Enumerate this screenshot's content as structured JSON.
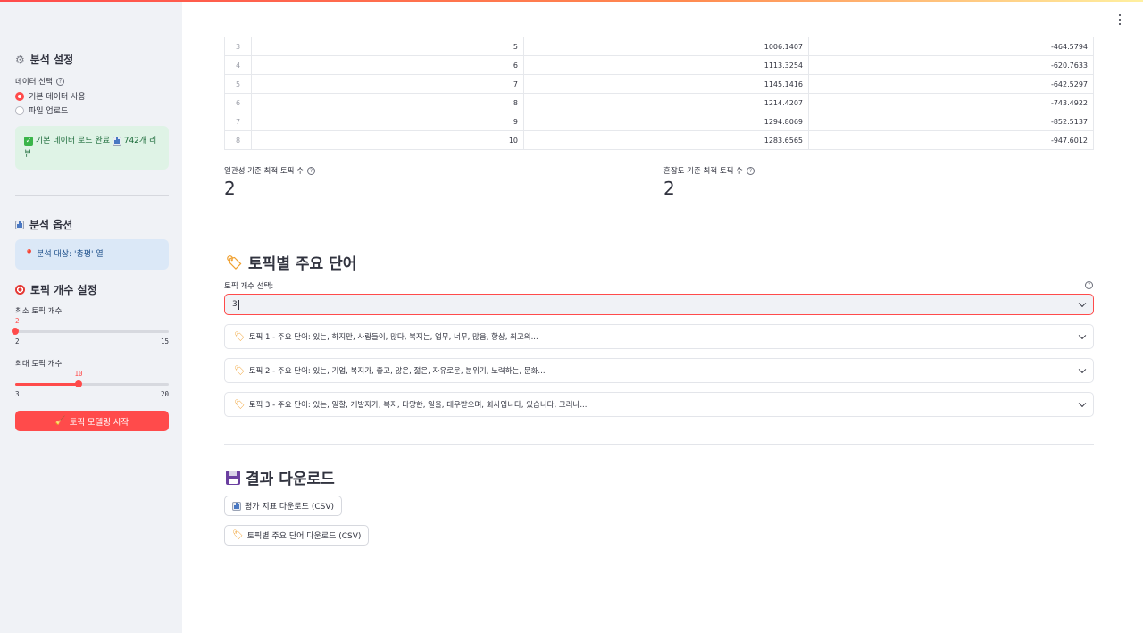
{
  "sidebar": {
    "settings_title": "분석 설정",
    "data_select_label": "데이터 선택",
    "radio_options": [
      "기본 데이터 사용",
      "파일 업로드"
    ],
    "radio_selected": 0,
    "load_alert_text": "기본 데이터 로드 완료",
    "load_alert_count": "742개 리뷰",
    "options_title": "분석 옵션",
    "target_alert_text": "분석 대상: '총평' 열",
    "topic_count_title": "토픽 개수 설정",
    "min_slider": {
      "label": "최소 토픽 개수",
      "value": "2",
      "min": "2",
      "max": "15"
    },
    "max_slider": {
      "label": "최대 토픽 개수",
      "value": "10",
      "min": "3",
      "max": "20"
    },
    "start_button": "토픽 모델링 시작"
  },
  "table": {
    "rows": [
      [
        "3",
        "5",
        "1006.1407",
        "-464.5794"
      ],
      [
        "4",
        "6",
        "1113.3254",
        "-620.7633"
      ],
      [
        "5",
        "7",
        "1145.1416",
        "-642.5297"
      ],
      [
        "6",
        "8",
        "1214.4207",
        "-743.4922"
      ],
      [
        "7",
        "9",
        "1294.8069",
        "-852.5137"
      ],
      [
        "8",
        "10",
        "1283.6565",
        "-947.6012"
      ]
    ]
  },
  "metrics": {
    "coherence_label": "일관성 기준 최적 토픽 수",
    "coherence_value": "2",
    "perplexity_label": "혼잡도 기준 최적 토픽 수",
    "perplexity_value": "2"
  },
  "topics_section": {
    "title": "토픽별 주요 단어",
    "select_label": "토픽 개수 선택:",
    "select_value": "3",
    "expanders": [
      "토픽 1 - 주요 단어: 있는, 하지만, 사람들이, 많다, 복지는, 업무, 너무, 많음, 항상, 최고의...",
      "토픽 2 - 주요 단어: 있는, 기업, 복지가, 좋고, 많은, 젊은, 자유로운, 분위기, 노력하는, 문화...",
      "토픽 3 - 주요 단어: 있는, 일할, 개발자가, 복지, 다양한, 일을, 대우받으며, 회사입니다, 있습니다, 그러나..."
    ]
  },
  "download_section": {
    "title": "결과 다운로드",
    "metrics_button": "평가 지표 다운로드 (CSV)",
    "words_button": "토픽별 주요 단어 다운로드 (CSV)"
  },
  "colors": {
    "accent": "#ff4b4b",
    "sidebar_bg": "#f0f2f6",
    "success_bg": "#dff3e6",
    "info_bg": "#dbe8f7"
  }
}
